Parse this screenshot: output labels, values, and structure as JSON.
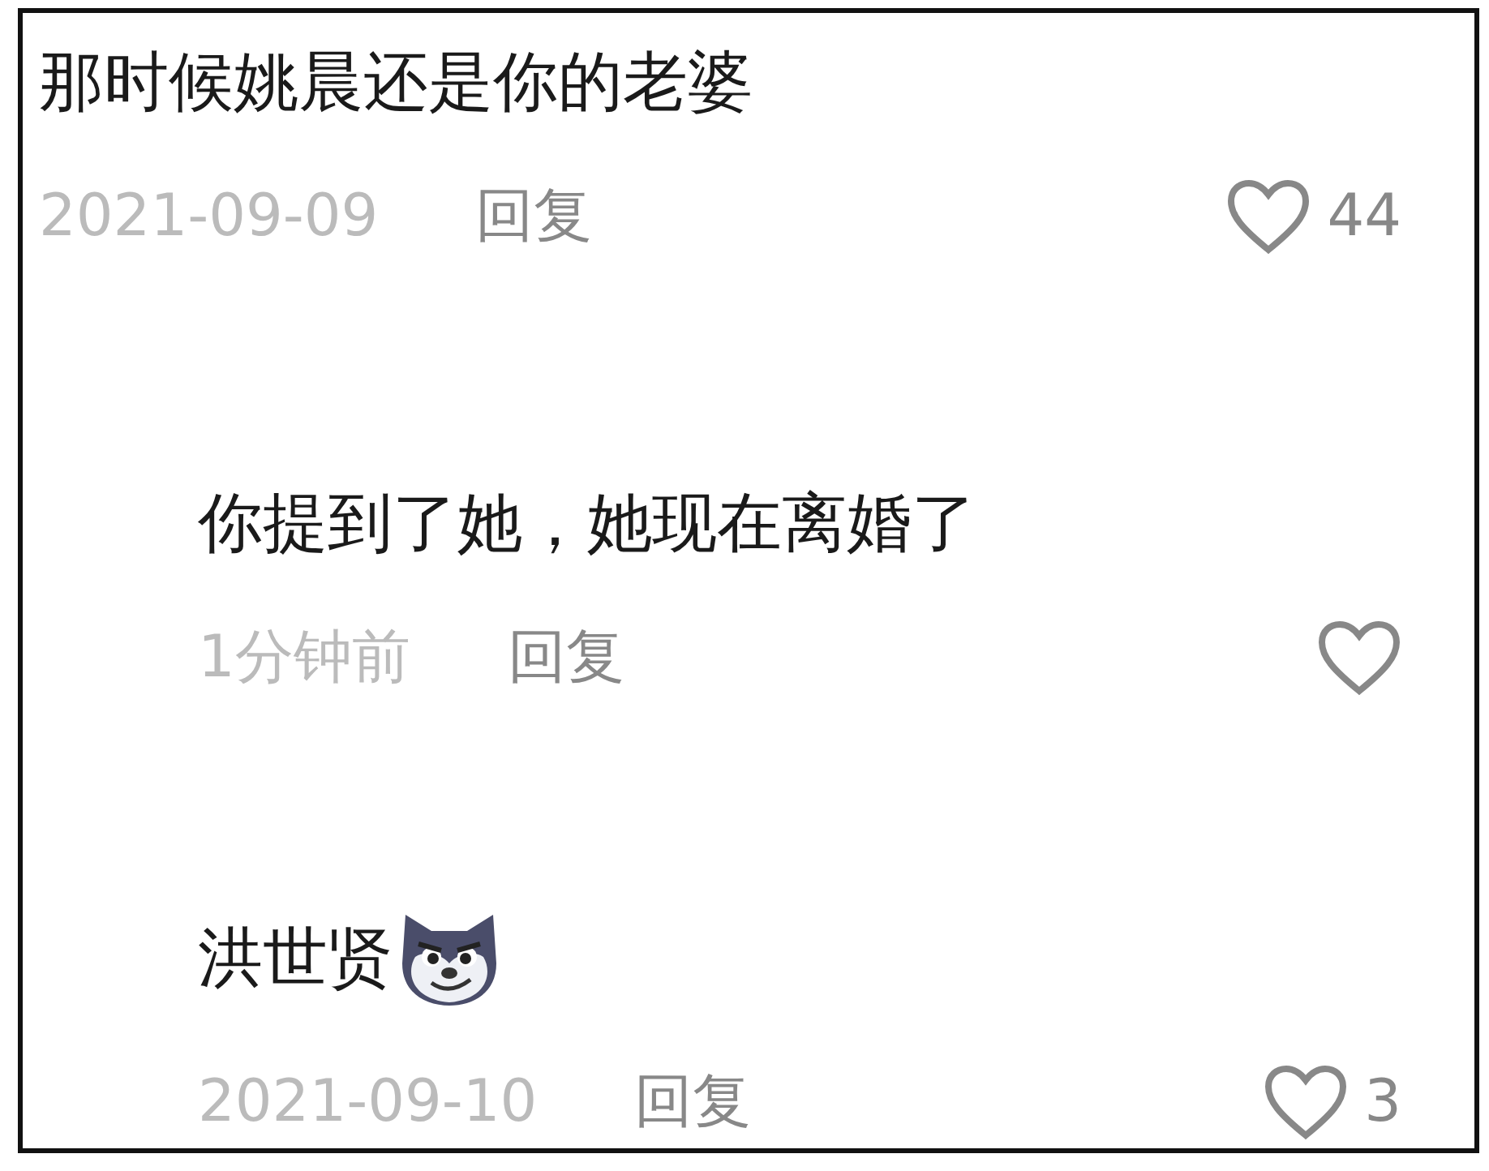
{
  "comments": [
    {
      "text": "那时候姚晨还是你的老婆",
      "time": "2021-09-09",
      "reply": "回复",
      "likes": "44",
      "has_emoji": false,
      "children": [
        {
          "text": "你提到了她，她现在离婚了",
          "time": "1分钟前",
          "reply": "回复",
          "has_emoji": false
        },
        {
          "text": "洪世贤",
          "time": "2021-09-10",
          "reply": "回复",
          "likes": "3",
          "has_emoji": true
        }
      ]
    }
  ]
}
